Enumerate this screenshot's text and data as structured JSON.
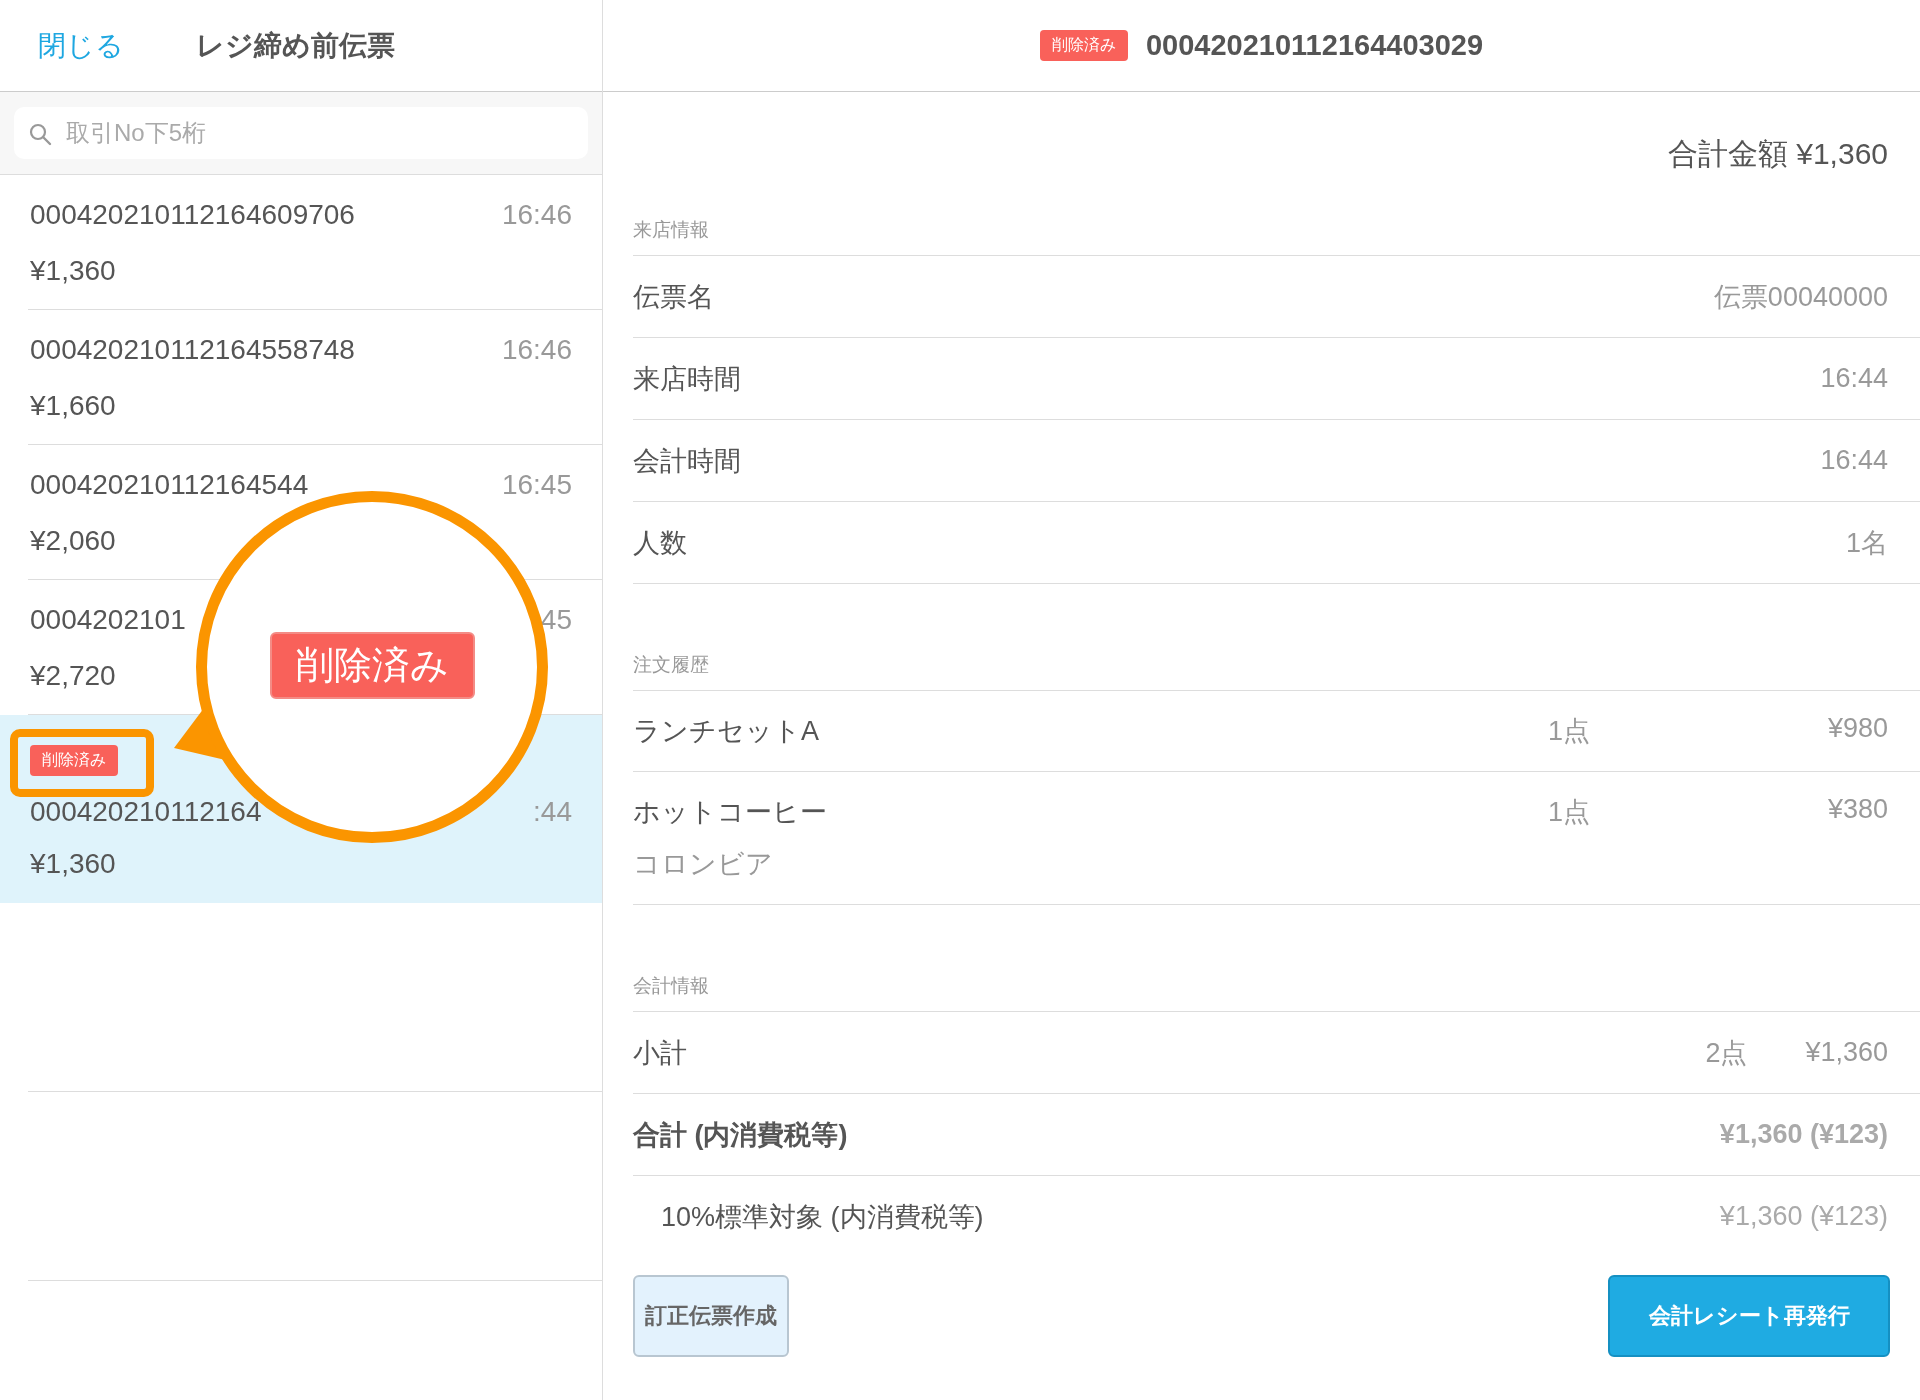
{
  "header": {
    "close": "閉じる",
    "title": "レジ締め前伝票"
  },
  "search": {
    "placeholder": "取引No下5桁"
  },
  "slips": [
    {
      "number": "000420210112164609706",
      "time": "16:46",
      "amount": "¥1,360",
      "selected": false
    },
    {
      "number": "000420210112164558748",
      "time": "16:46",
      "amount": "¥1,660",
      "selected": false
    },
    {
      "number": "000420210112164544",
      "time": "16:45",
      "amount": "¥2,060",
      "selected": false
    },
    {
      "number": "0004202101",
      "time": "45",
      "amount": "¥2,720",
      "selected": false
    },
    {
      "number": "000420210112164",
      "time": ":44",
      "amount": "¥1,360",
      "selected": true,
      "badge": "削除済み"
    }
  ],
  "detail": {
    "badge": "削除済み",
    "number": "000420210112164403029",
    "total": "合計金額 ¥1,360",
    "sections": [
      {
        "title": "来店情報",
        "rows": [
          {
            "kind": "info",
            "label": "伝票名",
            "value": "伝票00040000"
          },
          {
            "kind": "info",
            "label": "来店時間",
            "value": "16:44"
          },
          {
            "kind": "info",
            "label": "会計時間",
            "value": "16:44"
          },
          {
            "kind": "info",
            "label": "人数",
            "value": "1名"
          }
        ]
      },
      {
        "title": "注文履歴",
        "rows": [
          {
            "kind": "order",
            "label": "ランチセットA",
            "qty": "1点",
            "value": "¥980"
          },
          {
            "kind": "order",
            "label": "ホットコーヒー",
            "qty": "1点",
            "value": "¥380",
            "option": "コロンビア"
          }
        ]
      },
      {
        "title": "会計情報",
        "rows": [
          {
            "kind": "subtotal",
            "label": "小計",
            "qty": "2点",
            "value": "¥1,360"
          },
          {
            "kind": "total",
            "label": "合計 (内消費税等)",
            "value": "¥1,360 (¥123)"
          },
          {
            "kind": "tax",
            "label": "10%標準対象 (内消費税等)",
            "value": "¥1,360 (¥123)"
          }
        ]
      }
    ],
    "buttons": [
      {
        "kind": "secondary",
        "label": "訂正伝票作成"
      },
      {
        "kind": "primary",
        "label": "会計レシート再発行"
      }
    ]
  },
  "callout": {
    "label": "削除済み"
  }
}
